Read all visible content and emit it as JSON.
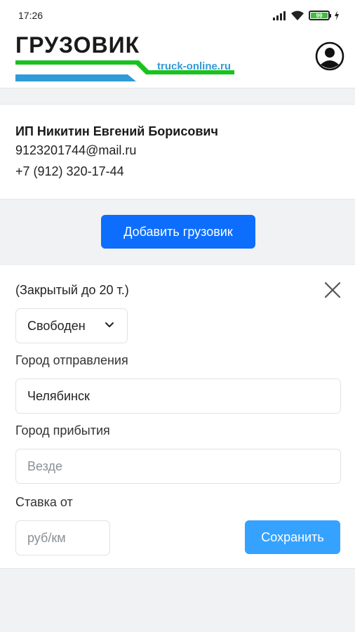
{
  "status_bar": {
    "time": "17:26",
    "battery_level": "99",
    "icons": [
      "signal-icon",
      "wifi-icon",
      "battery-icon",
      "charging-icon"
    ]
  },
  "header": {
    "logo_title": "ГРУЗОВИК",
    "logo_site": "truck-online.ru",
    "colors": {
      "green": "#19c21e",
      "blue": "#2f9bd8"
    },
    "profile_icon": "user-circle-icon"
  },
  "contact": {
    "name": "ИП Никитин Евгений Борисович",
    "email": "9123201744@mail.ru",
    "phone": "+7 (912) 320-17-44"
  },
  "add_truck_button": "Добавить грузовик",
  "truck": {
    "type": "(Закрытый до 20 т.)",
    "status": "Свободен",
    "departure_label": "Город отправления",
    "departure_value": "Челябинск",
    "arrival_label": "Город прибытия",
    "arrival_placeholder": "Везде",
    "rate_label": "Ставка от",
    "rate_placeholder": "руб/км",
    "save_label": "Сохранить"
  },
  "colors": {
    "primary": "#0d6efd",
    "save": "#36a2ff",
    "background": "#f1f2f4"
  }
}
